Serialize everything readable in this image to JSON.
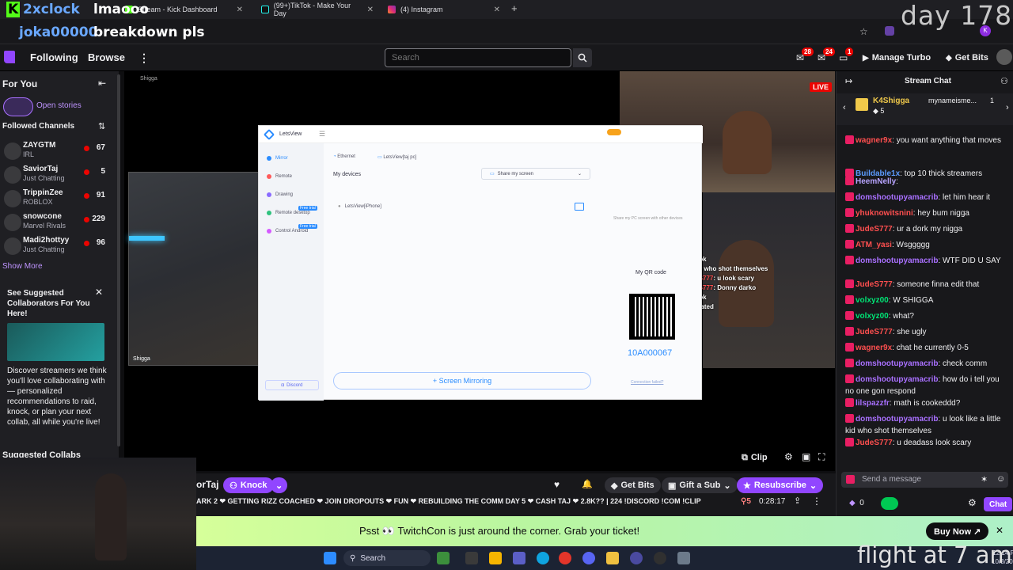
{
  "browser": {
    "tabs": [
      {
        "title": "Stream - Kick Dashboard"
      },
      {
        "title": "(99+)TikTok - Make Your Day"
      },
      {
        "title": "(4) Instagram"
      }
    ]
  },
  "overlay_text": {
    "top_left_line1": "2xclock",
    "top_left_line1_b": "lmaooo",
    "top_left_line2": "joka00000",
    "top_left_line2_b": "breakdown pls",
    "top_right": "day 178",
    "bottom_right": "flight at 7 am"
  },
  "topnav": {
    "following": "Following",
    "browse": "Browse",
    "search_placeholder": "Search",
    "badge_1": "28",
    "badge_2": "24",
    "badge_3": "1",
    "manage_turbo": "Manage Turbo",
    "get_bits": "Get Bits"
  },
  "sidebar": {
    "for_you": "For You",
    "open_stories": "Open stories",
    "followed_channels": "Followed Channels",
    "channels": [
      {
        "name": "ZAYGTM",
        "game": "IRL",
        "viewers": "67"
      },
      {
        "name": "SaviorTaj",
        "game": "Just Chatting",
        "viewers": "5"
      },
      {
        "name": "TrippinZee",
        "game": "ROBLOX",
        "viewers": "91"
      },
      {
        "name": "snowcone",
        "game": "Marvel Rivals",
        "viewers": "229"
      },
      {
        "name": "Madi2hottyy",
        "game": "Just Chatting",
        "viewers": "96"
      }
    ],
    "show_more": "Show More",
    "suggest_title": "See Suggested Collaborators For You Here!",
    "suggest_body": "Discover streamers we think you'll love collaborating with — personalized recommendations to raid, knock, or plan your next collab, all while you're live!",
    "suggested_collabs": "Suggested Collabs"
  },
  "player": {
    "label_top": "Shigga",
    "label_cam": "Shigga",
    "live": "LIVE",
    "clip": "Clip"
  },
  "letsview": {
    "app_name": "LetsView",
    "menu": [
      "Mirror",
      "Remote",
      "Drawing",
      "Remote desktop",
      "Control Android"
    ],
    "free_trial": "Free trial",
    "network": "Ethernet",
    "device_pc": "LetsView[taj pc]",
    "my_devices": "My devices",
    "share_screen": "Share my screen",
    "device_item": "LetsView[iPhone]",
    "qr_label": "My QR code",
    "code": "10A000067",
    "screen_mirroring": "+ Screen Mirroring",
    "discord": "Discord",
    "connection_failed": "Connection failed?",
    "share_hint": "Share my PC screen with other devices"
  },
  "chat": {
    "title": "Stream Chat",
    "pinned_user": "K4Shigga",
    "pinned_count": "5",
    "pinned_user2": "mynameisme...",
    "pinned_count2": "1",
    "messages": [
      {
        "user": "wagner9x",
        "color": "#ff4f4f",
        "text": ": you want anything that moves"
      },
      {
        "user": "Buildable1x",
        "color": "#5c9cff",
        "text": ": top 10 thick streamers"
      },
      {
        "user": "HeemNelly",
        "color": "#b8a4ff",
        "text": ":"
      },
      {
        "user": "domshootupyamacrib",
        "color": "#a970ff",
        "text": ": let him hear it"
      },
      {
        "user": "yhuknowitsnini",
        "color": "#ff4f4f",
        "text": ": hey bum nigga"
      },
      {
        "user": "JudeS777",
        "color": "#ff4f4f",
        "text": ": ur a dork my nigga"
      },
      {
        "user": "ATM_yasi",
        "color": "#ff4f4f",
        "text": ": Wsggggg"
      },
      {
        "user": "domshootupyamacrib",
        "color": "#a970ff",
        "text": ": WTF DID U SAY"
      },
      {
        "user": "JudeS777",
        "color": "#ff4f4f",
        "text": ": someone finna edit that"
      },
      {
        "user": "volxyz00",
        "color": "#00e676",
        "text": ": W SHIGGA"
      },
      {
        "user": "volxyz00",
        "color": "#00e676",
        "text": ": what?"
      },
      {
        "user": "JudeS777",
        "color": "#ff4f4f",
        "text": ": she ugly"
      },
      {
        "user": "wagner9x",
        "color": "#ff4f4f",
        "text": ": chat he currently 0-5"
      },
      {
        "user": "domshootupyamacrib",
        "color": "#a970ff",
        "text": ": check comm"
      },
      {
        "user": "domshootupyamacrib",
        "color": "#a970ff",
        "text": ": how do i tell you no one gon respond"
      },
      {
        "user": "lilspazzfr",
        "color": "#a970ff",
        "text": ": math is cookeddd?"
      },
      {
        "user": "domshootupyamacrib",
        "color": "#a970ff",
        "text": ": u look like a little kid who shot themselves"
      },
      {
        "user": "JudeS777",
        "color": "#ff4f4f",
        "text": ": u deadass look scary"
      }
    ],
    "send_placeholder": "Send a message",
    "points": "0",
    "chat_btn": "Chat"
  },
  "overlay_chat": {
    "line1": "u look",
    "line2": "little kid who shot themselves",
    "line3_user": "JudeS777",
    "line3": ": u look scary",
    "line4_user": "JudeS777",
    "line4": ": Donny darko",
    "line5": "u look",
    "line6": "constipated"
  },
  "infobar": {
    "channel": "orTaj",
    "knock": "Knock",
    "get_bits": "Get Bits",
    "gift_sub": "Gift a Sub",
    "resubscribe": "Resubscribe",
    "ticker": "ARK 2 ❤ GETTING RIZZ COACHED ❤ JOIN DROPOUTS ❤ FUN ❤ REBUILDING THE COMM DAY 5 ❤ CASH TAJ ❤ 2.8K?? | 224 !DISCORD !COM !CLIP",
    "viewers": "5",
    "uptime": "0:28:17"
  },
  "banner": {
    "text": "Psst 👀 TwitchCon is just around the corner. Grab your ticket!",
    "buy_now": "Buy Now ↗"
  },
  "taskbar": {
    "search": "Search",
    "time": "12:14 PM",
    "date": "10/3/2025"
  }
}
